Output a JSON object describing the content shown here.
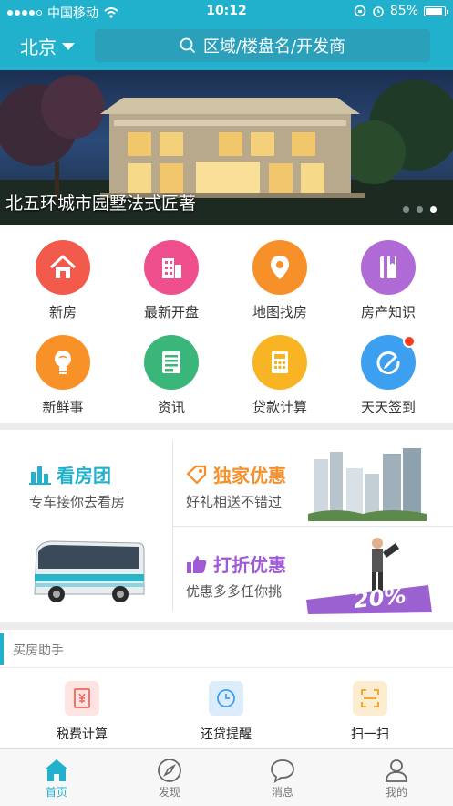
{
  "status": {
    "carrier": "中国移动",
    "time": "10:12",
    "battery": "85%"
  },
  "header": {
    "city": "北京",
    "search_placeholder": "区域/楼盘名/开发商"
  },
  "banner": {
    "caption": "北五环城市园墅法式匠著",
    "active_dot": 3,
    "dot_count": 3
  },
  "grid": [
    {
      "label": "新房",
      "color": "#f25b4b",
      "icon": "house-icon"
    },
    {
      "label": "最新开盘",
      "color": "#f04f8d",
      "icon": "building-icon"
    },
    {
      "label": "地图找房",
      "color": "#f8902a",
      "icon": "map-pin-icon"
    },
    {
      "label": "房产知识",
      "color": "#b06ad6",
      "icon": "book-icon"
    },
    {
      "label": "新鲜事",
      "color": "#f89228",
      "icon": "lightbulb-icon"
    },
    {
      "label": "资讯",
      "color": "#3bb67a",
      "icon": "news-icon"
    },
    {
      "label": "贷款计算",
      "color": "#f9b423",
      "icon": "calculator-icon"
    },
    {
      "label": "天天签到",
      "color": "#3d9ff0",
      "icon": "sign-in-icon"
    }
  ],
  "promo": {
    "tour": {
      "title": "看房团",
      "subtitle": "专车接你去看房",
      "color": "#21b1cc"
    },
    "exclusive": {
      "title": "独家优惠",
      "subtitle": "好礼相送不错过",
      "color": "#f5902a"
    },
    "discount": {
      "title": "打折优惠",
      "subtitle": "优惠多多任你挑",
      "color": "#a05ad6"
    },
    "discount_art_text": "20%"
  },
  "helper": {
    "title": "买房助手",
    "items": [
      {
        "label": "税费计算",
        "color": "#f0685a",
        "bg": "#fde4e2",
        "icon": "tax-icon"
      },
      {
        "label": "还贷提醒",
        "color": "#3d9ff0",
        "bg": "#dcecfb",
        "icon": "clock-icon"
      },
      {
        "label": "扫一扫",
        "color": "#f0a020",
        "bg": "#fcecd0",
        "icon": "scan-icon"
      }
    ]
  },
  "tabs": [
    {
      "label": "首页",
      "icon": "home-icon",
      "active": true
    },
    {
      "label": "发现",
      "icon": "compass-icon",
      "active": false
    },
    {
      "label": "消息",
      "icon": "message-icon",
      "active": false
    },
    {
      "label": "我的",
      "icon": "profile-icon",
      "active": false
    }
  ]
}
